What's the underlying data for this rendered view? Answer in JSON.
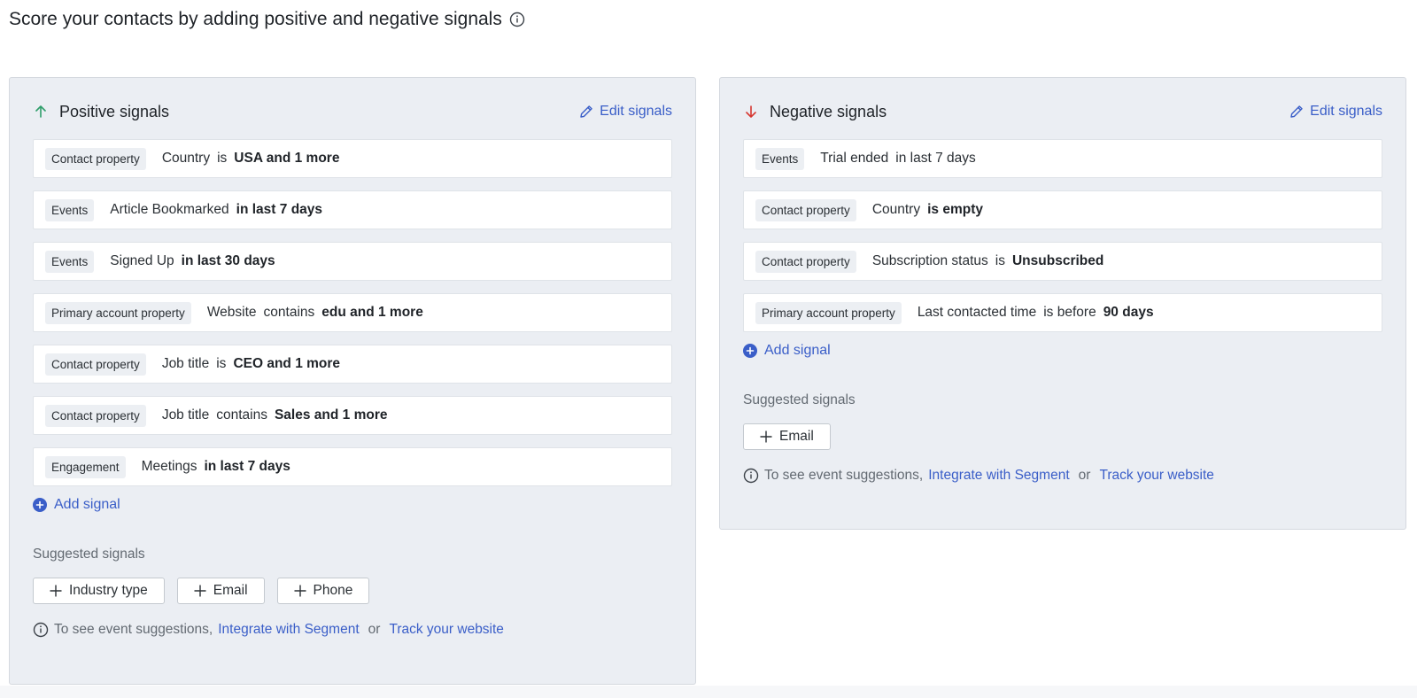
{
  "page_title": "Score your contacts by adding positive and negative signals",
  "colors": {
    "accent": "#3a5ec8",
    "positive": "#2f9e6b",
    "negative": "#d6362f",
    "panel_bg": "#ebeef3"
  },
  "positive": {
    "title": "Positive signals",
    "edit_label": "Edit signals",
    "rows": [
      {
        "tag": "Contact property",
        "prop": "Country",
        "op": "is",
        "val": "USA and 1 more"
      },
      {
        "tag": "Events",
        "prop": "Article Bookmarked",
        "op": "",
        "val": "in last 7 days"
      },
      {
        "tag": "Events",
        "prop": "Signed Up",
        "op": "",
        "val": "in last 30 days"
      },
      {
        "tag": "Primary account property",
        "prop": "Website",
        "op": "contains",
        "val": "edu and 1 more"
      },
      {
        "tag": "Contact property",
        "prop": "Job title",
        "op": "is",
        "val": "CEO and 1 more"
      },
      {
        "tag": "Contact property",
        "prop": "Job title",
        "op": "contains",
        "val": "Sales and 1 more"
      },
      {
        "tag": "Engagement",
        "prop": "Meetings",
        "op": "",
        "val": "in last 7 days"
      }
    ],
    "add_signal_label": "Add signal",
    "suggested_label": "Suggested signals",
    "chips": [
      "Industry type",
      "Email",
      "Phone"
    ],
    "hint_text": "To see event suggestions,",
    "hint_link1": "Integrate with Segment",
    "hint_or": "or",
    "hint_link2": "Track your website"
  },
  "negative": {
    "title": "Negative signals",
    "edit_label": "Edit signals",
    "rows": [
      {
        "tag": "Events",
        "prop": "Trial ended",
        "op": "in last 7 days",
        "val": ""
      },
      {
        "tag": "Contact property",
        "prop": "Country",
        "op": "",
        "val": "is empty"
      },
      {
        "tag": "Contact property",
        "prop": "Subscription status",
        "op": "is",
        "val": "Unsubscribed"
      },
      {
        "tag": "Primary account property",
        "prop": "Last contacted time",
        "op": "is before",
        "val": "90 days"
      }
    ],
    "add_signal_label": "Add signal",
    "suggested_label": "Suggested signals",
    "chips": [
      "Email"
    ],
    "hint_text": "To see event suggestions,",
    "hint_link1": "Integrate with Segment",
    "hint_or": "or",
    "hint_link2": "Track your website"
  }
}
